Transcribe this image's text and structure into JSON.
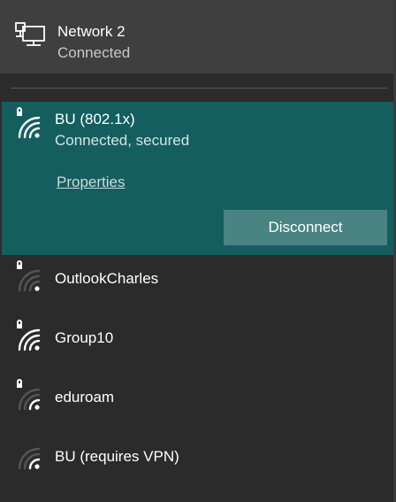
{
  "wired": {
    "name": "Network 2",
    "status": "Connected",
    "icon": "ethernet-monitor-icon"
  },
  "active_network": {
    "name": "BU (802.1x)",
    "status": "Connected, secured",
    "properties_label": "Properties",
    "disconnect_label": "Disconnect",
    "secured": true,
    "signal_bars": 4,
    "icon": "wifi-secured-icon",
    "highlight_color": "#155e60"
  },
  "networks": [
    {
      "name": "OutlookCharles",
      "secured": true,
      "signal_bars": 1,
      "icon": "wifi-secured-icon"
    },
    {
      "name": "Group10",
      "secured": true,
      "signal_bars": 4,
      "icon": "wifi-secured-icon"
    },
    {
      "name": "eduroam",
      "secured": true,
      "signal_bars": 2,
      "icon": "wifi-secured-icon"
    },
    {
      "name": "BU (requires VPN)",
      "secured": false,
      "signal_bars": 2,
      "icon": "wifi-icon"
    }
  ]
}
